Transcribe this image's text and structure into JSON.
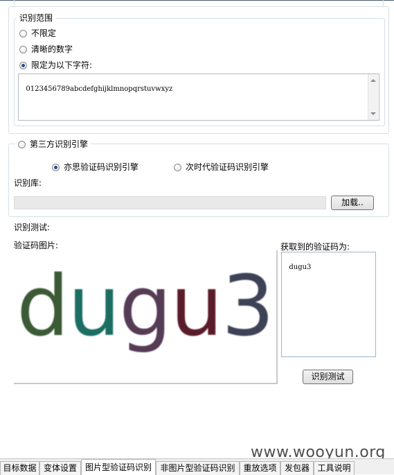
{
  "scope_group": {
    "legend": "识别范围",
    "options": [
      "不限定",
      "清晰的数字",
      "限定为以下字符:"
    ],
    "selected_index": 2,
    "charset_value": "0123456789abcdefghijklmnopqrstuvwxyz"
  },
  "engine_group": {
    "legend": "第三方识别引擎",
    "options": [
      "亦思验证码识别引擎",
      "次时代验证码识别引擎"
    ],
    "selected_index": 0,
    "library_label": "识别库:",
    "load_button": "加载.."
  },
  "test_section": {
    "title": "识别测试:",
    "image_label": "验证码图片:",
    "captcha_text": "dugu3",
    "result_label": "获取到的验证码为:",
    "result_value": "dugu3",
    "test_button": "识别测试"
  },
  "tabs": [
    {
      "label": "目标数据",
      "active": false
    },
    {
      "label": "变体设置",
      "active": false
    },
    {
      "label": "图片型验证码识别",
      "active": true
    },
    {
      "label": "非图片型验证码识别",
      "active": false
    },
    {
      "label": "重放选项",
      "active": false
    },
    {
      "label": "发包器",
      "active": false
    },
    {
      "label": "工具说明",
      "active": false
    }
  ],
  "watermark": "www.wooyun.org",
  "colors": {
    "captcha_d": "#3a5a35",
    "captcha_u": "#1f6e62",
    "captcha_g": "#573a54",
    "captcha_u2": "#5a1f2c",
    "captcha_3": "#3c4256",
    "radio_dot": "#2a4f86",
    "frame_border": "#d5dfe5"
  }
}
